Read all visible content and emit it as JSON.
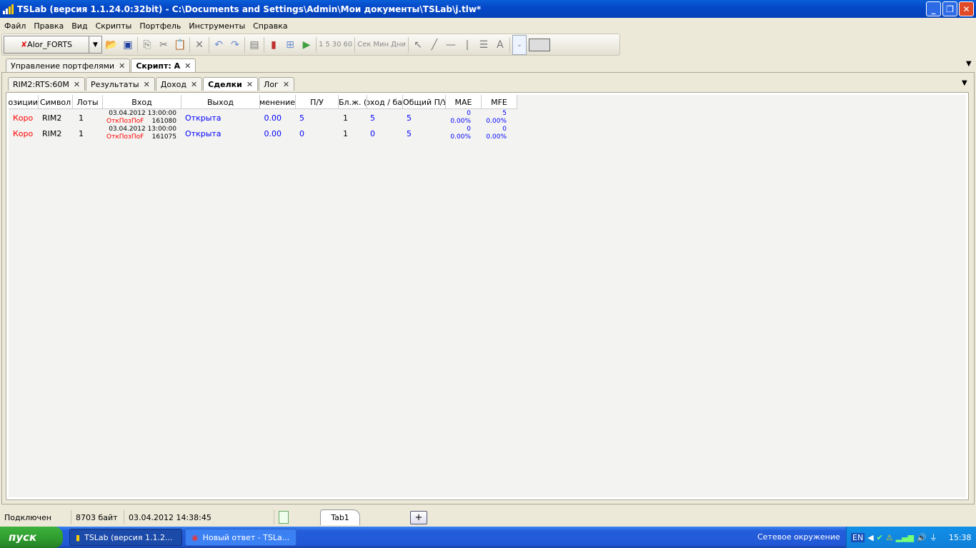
{
  "window": {
    "title": "TSLab (версия 1.1.24.0:32bit) - C:\\Documents and Settings\\Admin\\Мои документы\\TSLab\\j.tlw*"
  },
  "menu": [
    "Файл",
    "Правка",
    "Вид",
    "Скрипты",
    "Портфель",
    "Инструменты",
    "Справка"
  ],
  "toolbar": {
    "connection": "Alor_FORTS",
    "intervals": [
      "1",
      "5",
      "30",
      "60"
    ],
    "units": [
      "Сек",
      "Мин",
      "Дни"
    ]
  },
  "outer_tabs": [
    {
      "label": "Управление портфелями"
    },
    {
      "label": "Скрипт: А"
    }
  ],
  "inner_tabs": [
    {
      "label": "RIM2:RTS:60M"
    },
    {
      "label": "Результаты"
    },
    {
      "label": "Доход"
    },
    {
      "label": "Сделки"
    },
    {
      "label": "Лог"
    }
  ],
  "table": {
    "columns": [
      "Позиции",
      "Символ",
      "Лоты",
      "Вход",
      "Выход",
      "Изменение",
      "П/У",
      "Бл.ж. (б",
      "Доход / ба",
      "Общий П/У",
      "MAE",
      "MFE"
    ],
    "rows": [
      {
        "pos": "Коро",
        "symbol": "RIM2",
        "lots": "1",
        "entry_date": "03.04.2012 13:00:00",
        "entry_signal": "ОткПозПоF",
        "entry_price": "161080",
        "exit": "Открыта",
        "change": "0.00",
        "pl": "5",
        "bars": "1",
        "income": "5",
        "total": "5",
        "mae": "0",
        "mae_pct": "0.00%",
        "mfe": "5",
        "mfe_pct": "0.00%"
      },
      {
        "pos": "Коро",
        "symbol": "RIM2",
        "lots": "1",
        "entry_date": "03.04.2012 13:00:00",
        "entry_signal": "ОткПозПоF",
        "entry_price": "161075",
        "exit": "Открыта",
        "change": "0.00",
        "pl": "0",
        "bars": "1",
        "income": "0",
        "total": "5",
        "mae": "0",
        "mae_pct": "0.00%",
        "mfe": "0",
        "mfe_pct": "0.00%"
      }
    ]
  },
  "status": {
    "connection": "Подключен",
    "size": "8703 байт",
    "datetime": "03.04.2012 14:38:45",
    "tab": "Tab1",
    "add": "+"
  },
  "taskbar": {
    "start": "пуск",
    "tasks": [
      "TSLab (версия 1.1.2...",
      "Новый ответ - TSLa..."
    ],
    "network": "Сетевое окружение",
    "lang": "EN",
    "clock": "15:38"
  }
}
